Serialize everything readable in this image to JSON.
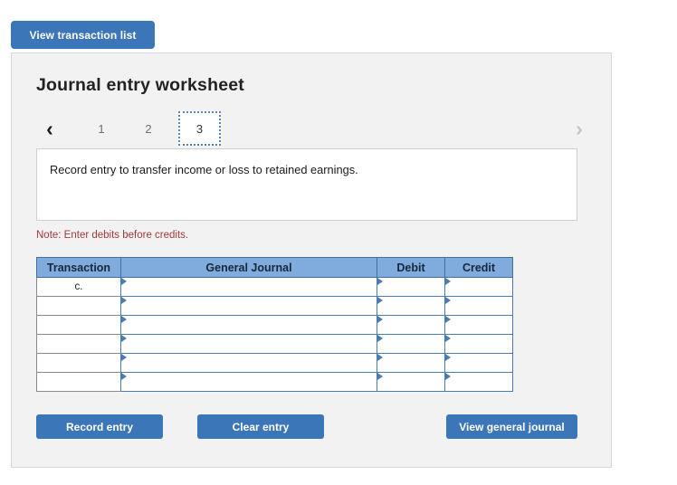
{
  "top": {
    "view_transaction_list": "View transaction list"
  },
  "panel": {
    "title": "Journal entry worksheet",
    "pager": {
      "prev_icon": "chevron-left-icon",
      "next_icon": "chevron-right-icon",
      "prev_glyph": "‹",
      "next_glyph": "›",
      "pages": [
        "1",
        "2",
        "3"
      ],
      "active_page": "3"
    },
    "instruction": "Record entry to transfer income or loss to retained earnings.",
    "note": "Note: Enter debits before credits.",
    "table": {
      "headers": [
        "Transaction",
        "General Journal",
        "Debit",
        "Credit"
      ],
      "rows": [
        {
          "transaction": "c.",
          "general_journal": "",
          "debit": "",
          "credit": ""
        },
        {
          "transaction": "",
          "general_journal": "",
          "debit": "",
          "credit": ""
        },
        {
          "transaction": "",
          "general_journal": "",
          "debit": "",
          "credit": ""
        },
        {
          "transaction": "",
          "general_journal": "",
          "debit": "",
          "credit": ""
        },
        {
          "transaction": "",
          "general_journal": "",
          "debit": "",
          "credit": ""
        },
        {
          "transaction": "",
          "general_journal": "",
          "debit": "",
          "credit": ""
        }
      ]
    },
    "buttons": {
      "record_entry": "Record entry",
      "clear_entry": "Clear entry",
      "view_general_journal": "View general journal"
    }
  },
  "colors": {
    "button_blue": "#3a76b8",
    "header_blue": "#7fabdd",
    "panel_bg": "#f2f2f2",
    "note_red": "#a33a3a",
    "cell_border_blue": "#4a7cb0"
  }
}
